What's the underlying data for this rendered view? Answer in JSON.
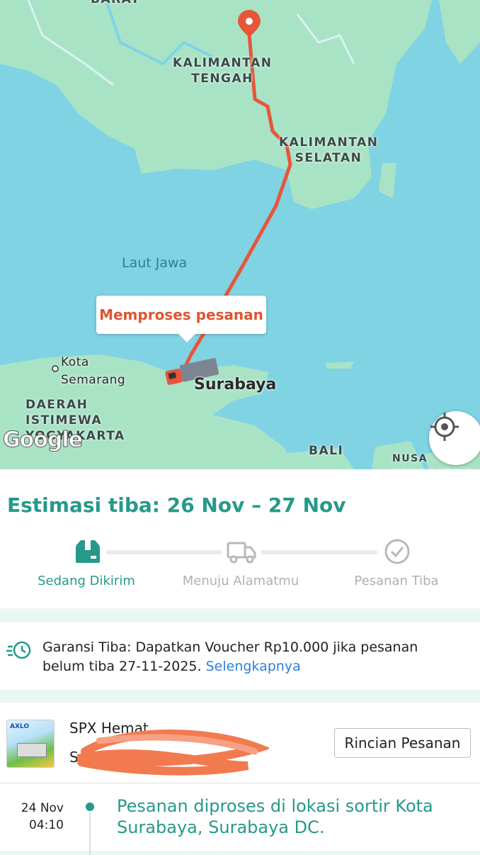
{
  "map": {
    "regions": [
      "KALIMANTAN\nTENGAH",
      "KALIMANTAN\nSELATAN",
      "DAERAH\nISTIMEWA\nYOGYAKARTA",
      "BALI"
    ],
    "region_top_label": "BARAT",
    "sea_label": "Laut Jawa",
    "city_semarang": "Kota\nSemarang",
    "city_surabaya": "Surabaya",
    "ntb_label": "NUSA\nTENGGARA B",
    "callout": "Memproses pesanan",
    "google_logo": "Google",
    "colors": {
      "sea": "#7fd3e3",
      "land": "#a9e3c6",
      "route": "#e8553a"
    }
  },
  "eta": {
    "title": "Estimasi tiba: 26 Nov – 27 Nov",
    "steps": [
      {
        "label": "Sedang Dikirim",
        "icon": "package-box-icon",
        "active": true
      },
      {
        "label": "Menuju Alamatmu",
        "icon": "delivery-truck-icon",
        "active": false
      },
      {
        "label": "Pesanan Tiba",
        "icon": "check-circle-icon",
        "active": false
      }
    ]
  },
  "guarantee": {
    "text": "Garansi Tiba: Dapatkan Voucher Rp10.000 jika pesanan belum tiba 27-11-2025.",
    "link": "Selengkapnya"
  },
  "shipment": {
    "courier": "SPX Hemat",
    "tracking_visible": "S",
    "detail_button": "Rincian Pesanan"
  },
  "events": [
    {
      "date": "24 Nov",
      "time": "04:10",
      "text": "Pesanan diproses di lokasi sortir Kota Surabaya, Surabaya DC."
    }
  ]
}
